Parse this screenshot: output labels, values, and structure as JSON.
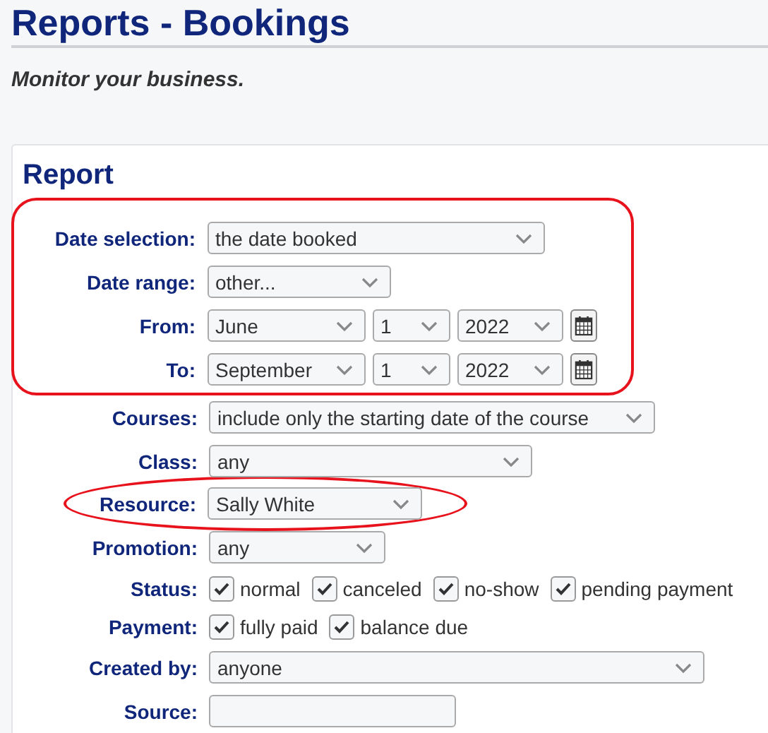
{
  "page": {
    "title": "Reports - Bookings",
    "subtitle": "Monitor your business."
  },
  "report": {
    "heading": "Report",
    "rows": [
      {
        "label": "Date selection:",
        "kind": "select",
        "value": "the date booked",
        "highlighted": true
      },
      {
        "label": "Date range:",
        "kind": "select",
        "value": "other...",
        "highlighted": true
      },
      {
        "label": "From:",
        "kind": "date",
        "parts": [
          "June",
          "1",
          "2022"
        ],
        "highlighted": true
      },
      {
        "label": "To:",
        "kind": "date",
        "parts": [
          "September",
          "1",
          "2022"
        ],
        "highlighted": true
      },
      {
        "label": "Courses:",
        "kind": "select",
        "value": "include only the starting date of the course",
        "highlighted": false
      },
      {
        "label": "Class:",
        "kind": "select",
        "value": "any",
        "highlighted": false
      },
      {
        "label": "Resource:",
        "kind": "select",
        "value": "Sally White",
        "highlighted": true
      },
      {
        "label": "Promotion:",
        "kind": "select",
        "value": "any",
        "highlighted": false
      },
      {
        "label": "Status:",
        "kind": "checks",
        "highlighted": false,
        "options": [
          {
            "label": "normal",
            "checked": true
          },
          {
            "label": "canceled",
            "checked": true
          },
          {
            "label": "no-show",
            "checked": true
          },
          {
            "label": "pending payment",
            "checked": true
          }
        ]
      },
      {
        "label": "Payment:",
        "kind": "checks",
        "highlighted": false,
        "options": [
          {
            "label": "fully paid",
            "checked": true
          },
          {
            "label": "balance due",
            "checked": true
          }
        ]
      },
      {
        "label": "Created by:",
        "kind": "select",
        "value": "anyone",
        "highlighted": false
      },
      {
        "label": "Source:",
        "kind": "text",
        "highlighted": false
      }
    ]
  }
}
